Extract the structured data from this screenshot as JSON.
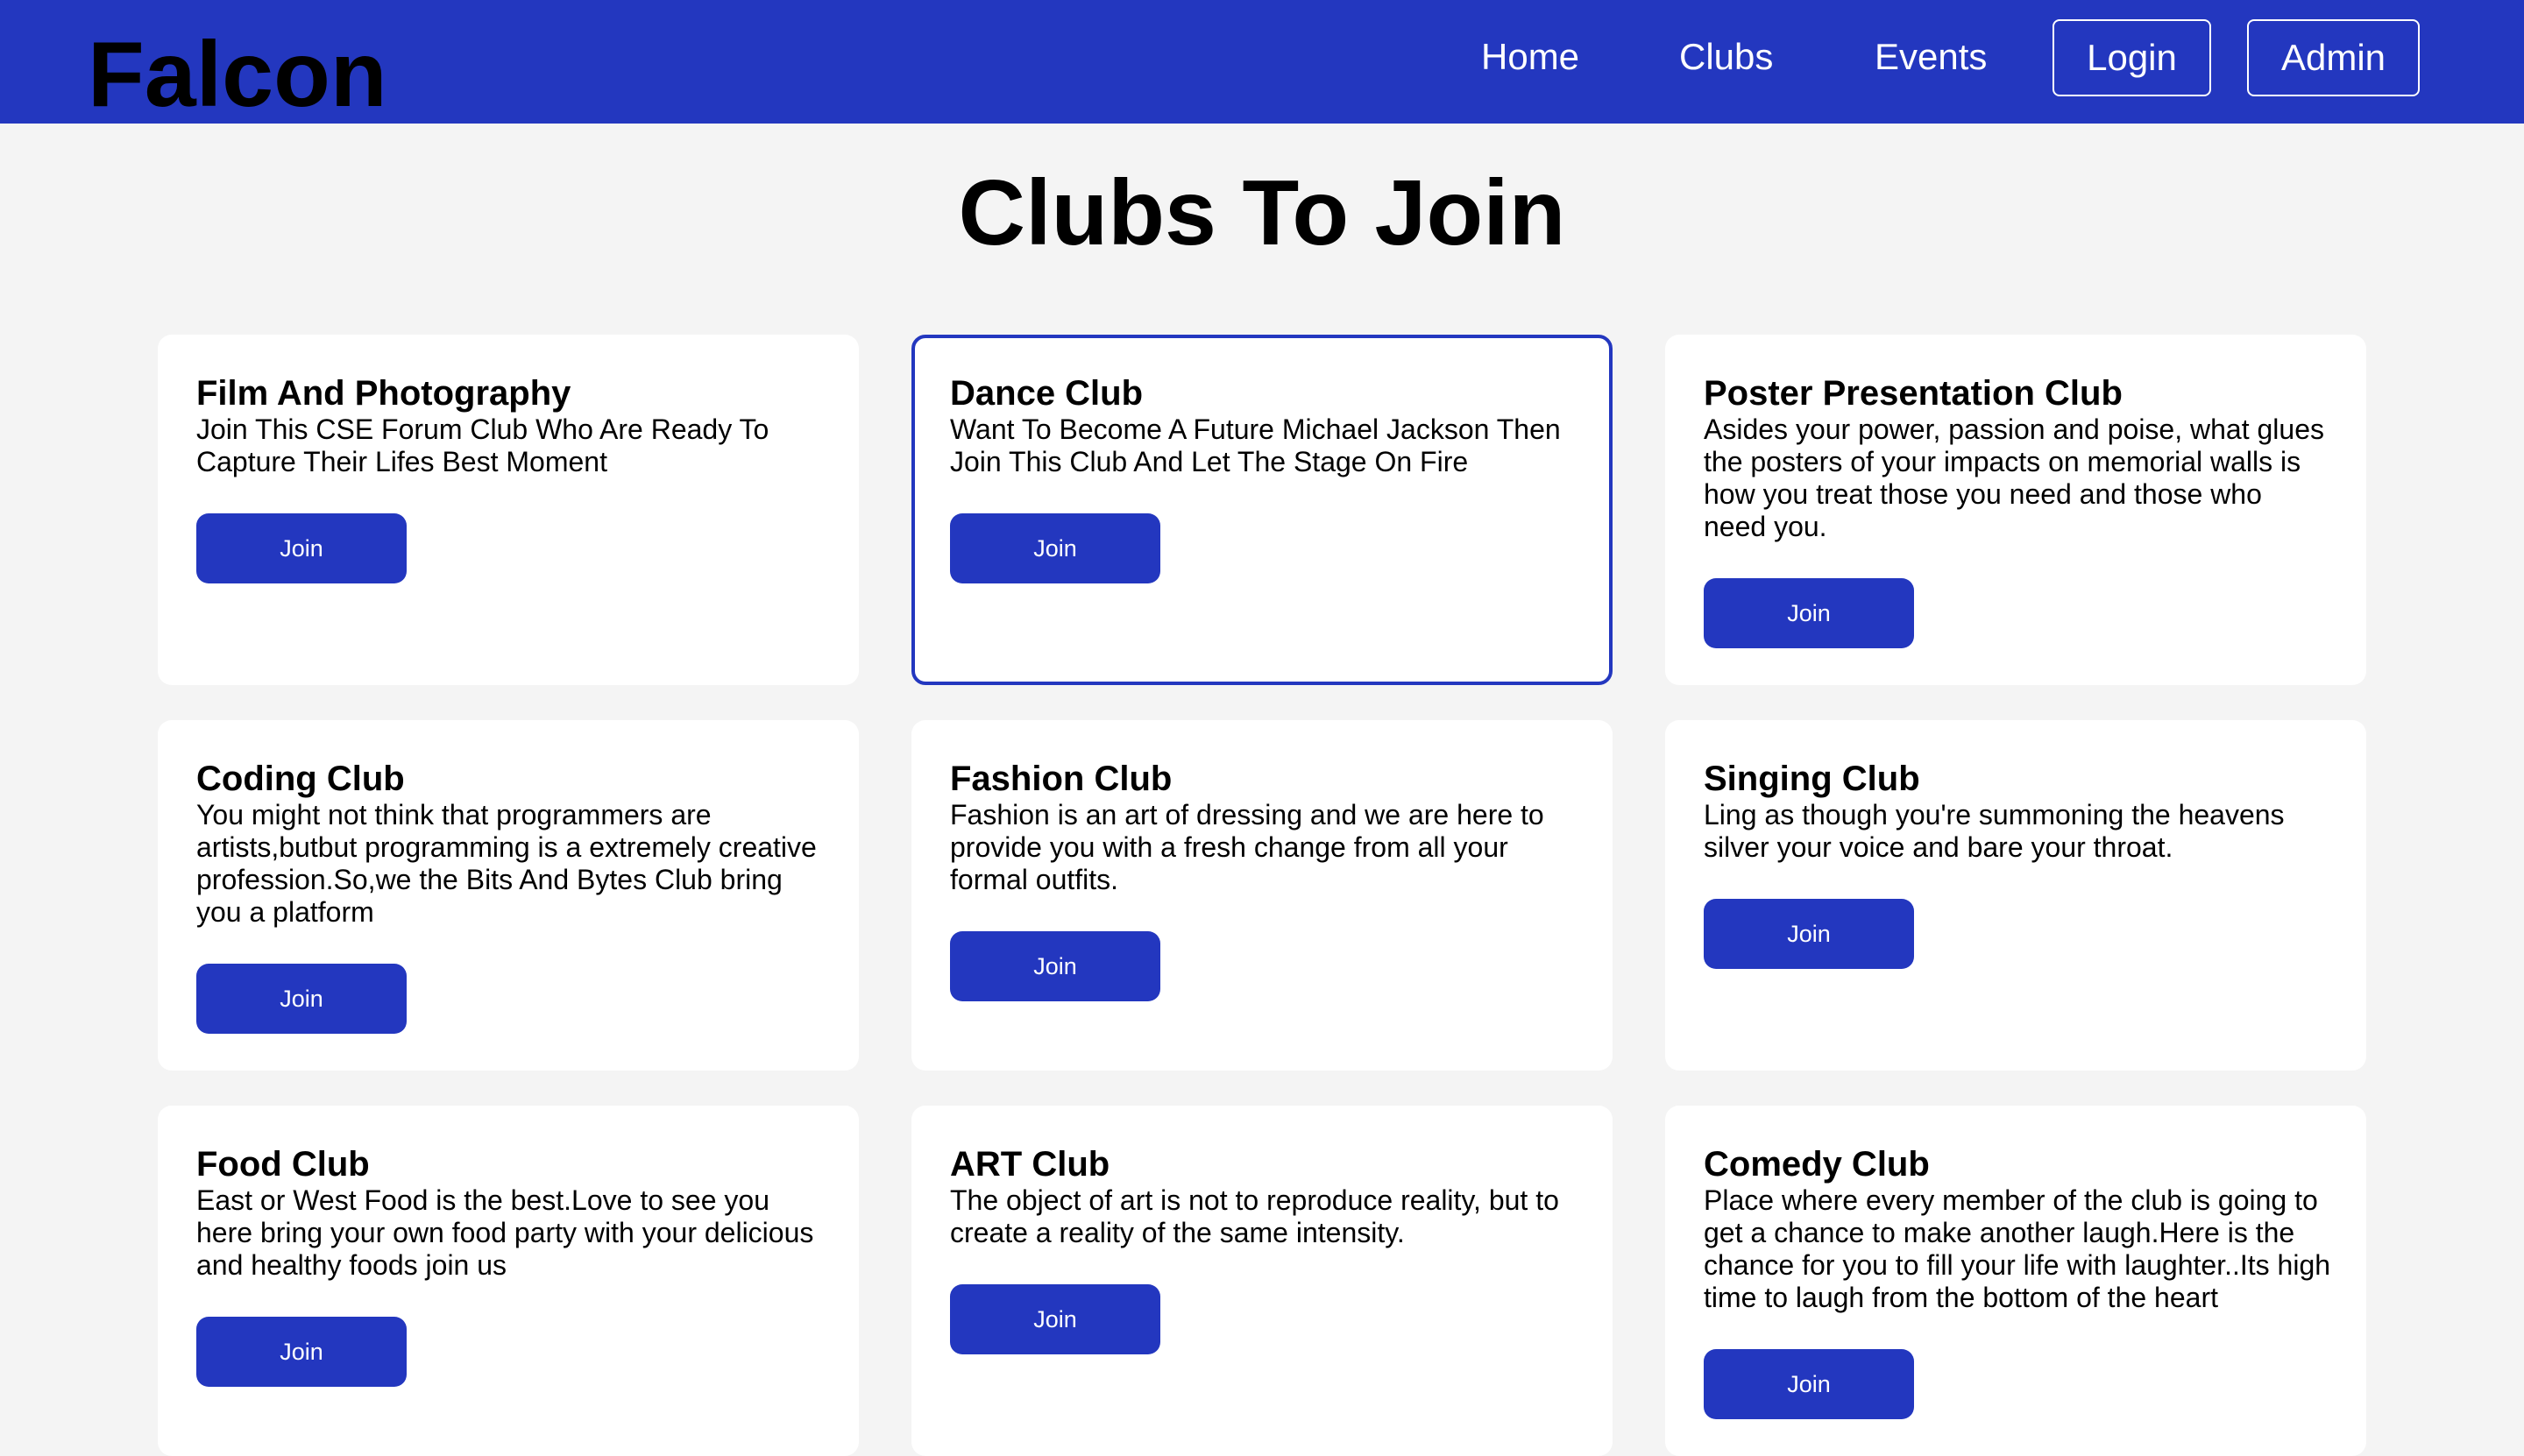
{
  "header": {
    "brand": "Falcon",
    "nav": {
      "home": "Home",
      "clubs": "Clubs",
      "events": "Events",
      "login": "Login",
      "admin": "Admin"
    }
  },
  "main": {
    "title": "Clubs To Join",
    "clubs": [
      {
        "title": "Film And Photography",
        "description": "Join This CSE Forum Club Who Are Ready To Capture Their Lifes Best Moment",
        "button": "Join"
      },
      {
        "title": "Dance Club",
        "description": "Want To Become A Future Michael Jackson Then Join This Club And Let The Stage On Fire",
        "button": "Join"
      },
      {
        "title": "Poster Presentation Club",
        "description": "Asides your power, passion and poise, what glues the posters of your impacts on memorial walls is how you treat those you need and those who need you.",
        "button": "Join"
      },
      {
        "title": "Coding Club",
        "description": "You might not think that programmers are artists,butbut programming is a extremely creative profession.So,we the Bits And Bytes Club bring you a platform",
        "button": "Join"
      },
      {
        "title": "Fashion Club",
        "description": "Fashion is an art of dressing and we are here to provide you with a fresh change from all your formal outfits.",
        "button": "Join"
      },
      {
        "title": "Singing Club",
        "description": "Ling as though you're summoning the heavens silver your voice and bare your throat.",
        "button": "Join"
      },
      {
        "title": "Food Club",
        "description": "East or West Food is the best.Love to see you here bring your own food party with your delicious and healthy foods join us",
        "button": "Join"
      },
      {
        "title": "ART Club",
        "description": "The object of art is not to reproduce reality, but to create a reality of the same intensity.",
        "button": "Join"
      },
      {
        "title": "Comedy Club",
        "description": "Place where every member of the club is going to get a chance to make another laugh.Here is the chance for you to fill your life with laughter..Its high time to laugh from the bottom of the heart",
        "button": "Join"
      }
    ]
  },
  "colors": {
    "accent": "#2337bf",
    "background": "#f4f4f4",
    "card": "#ffffff"
  }
}
